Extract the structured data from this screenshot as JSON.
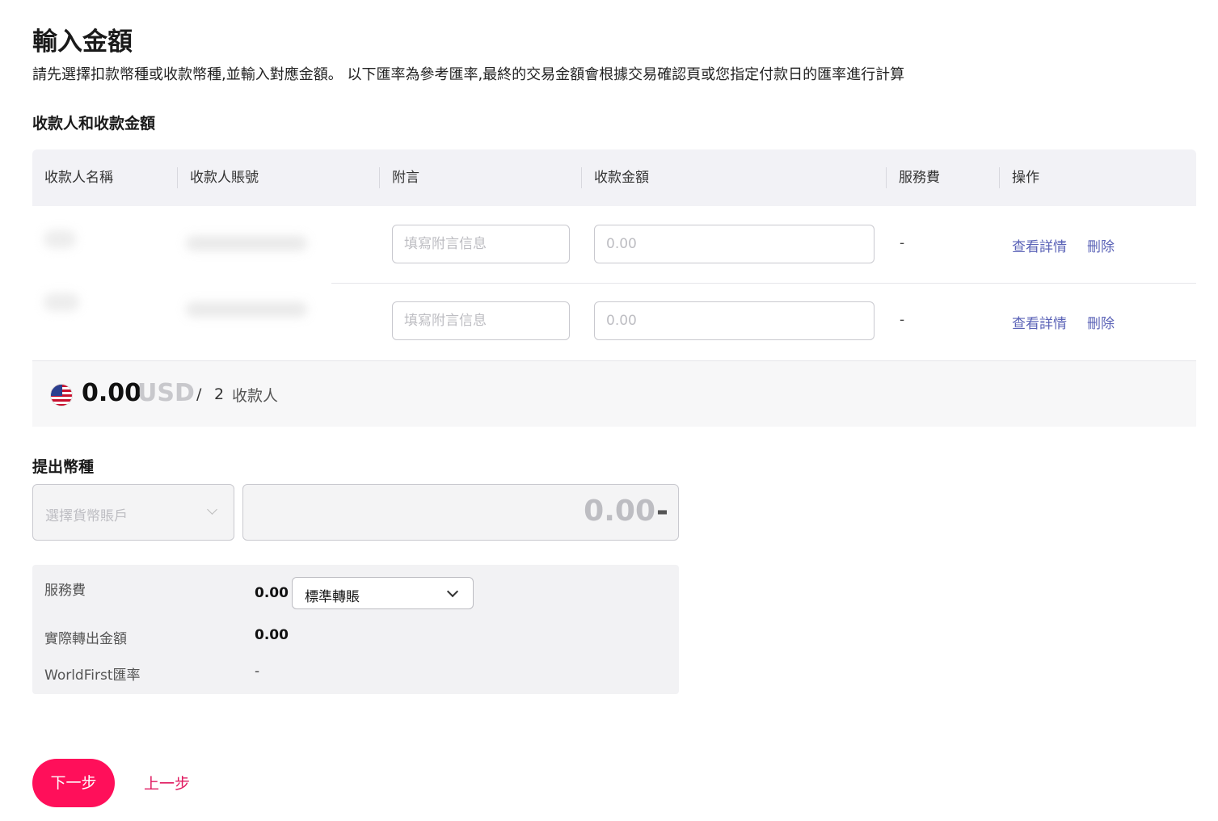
{
  "page": {
    "title": "輸入金額",
    "description": "請先選擇扣款幣種或收款幣種,並輸入對應金額。 以下匯率為參考匯率,最終的交易金額會根據交易確認頁或您指定付款日的匯率進行計算"
  },
  "payees_section": {
    "title": "收款人和收款金額",
    "columns": [
      "收款人名稱",
      "收款人賬號",
      "附言",
      "收款金額",
      "服務費",
      "操作"
    ],
    "rows": [
      {
        "remark_placeholder": "填寫附言信息",
        "amount_placeholder": "0.00",
        "fee": "-",
        "detail_link": "查看詳情",
        "delete_link": "刪除"
      },
      {
        "remark_placeholder": "填寫附言信息",
        "amount_placeholder": "0.00",
        "fee": "-",
        "detail_link": "查看詳情",
        "delete_link": "刪除"
      }
    ],
    "summary": {
      "flag_icon": "us-flag-icon",
      "total": "0.00",
      "currency": "USD",
      "separator": "/",
      "payee_count": "2",
      "payee_label": "收款人"
    }
  },
  "withdraw_section": {
    "title": "提出幣種",
    "account_placeholder": "選擇貨幣賬戶",
    "amount": "0.00",
    "amount_suffix": "-"
  },
  "fees": {
    "service_fee_label": "服務費",
    "service_fee_value": "0.00",
    "transfer_type": "標準轉賬",
    "actual_amount_label": "實際轉出金額",
    "actual_amount_value": "0.00",
    "rate_label": "WorldFirst匯率",
    "rate_value": "-"
  },
  "actions": {
    "next": "下一步",
    "prev": "上一步"
  },
  "colors": {
    "primary": "#ff0f5a",
    "link": "#5b63b7",
    "header_bg": "#f2f2f6"
  }
}
